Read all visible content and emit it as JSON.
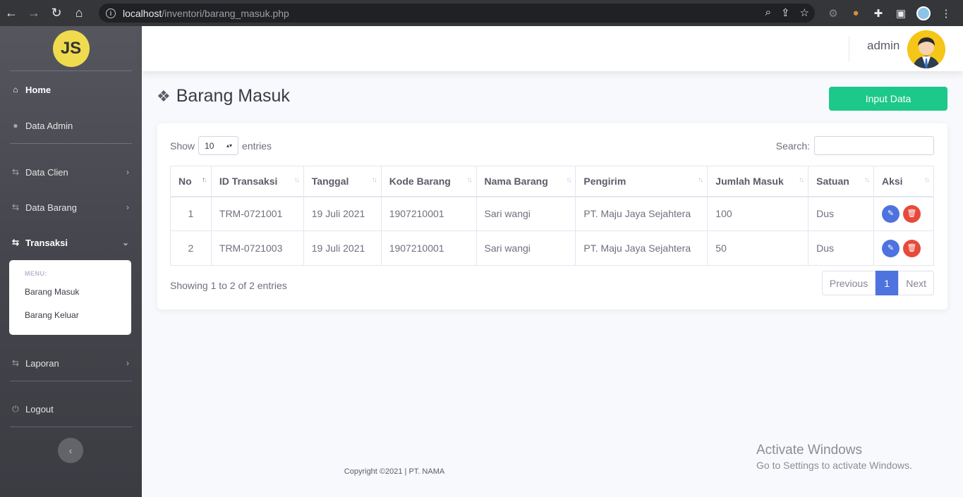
{
  "browser": {
    "url_host": "localhost",
    "url_path": "/inventori/barang_masuk.php"
  },
  "sidebar": {
    "logo": "JS",
    "items": [
      {
        "label": "Home",
        "icon": "home-icon"
      },
      {
        "label": "Data Admin",
        "icon": "user-icon"
      },
      {
        "label": "Data Clien",
        "icon": "exchange-icon"
      },
      {
        "label": "Data Barang",
        "icon": "exchange-icon"
      },
      {
        "label": "Transaksi",
        "icon": "exchange-icon"
      },
      {
        "label": "Laporan",
        "icon": "exchange-icon"
      },
      {
        "label": "Logout",
        "icon": "power-icon"
      }
    ],
    "submenu": {
      "header": "MENU:",
      "items": [
        "Barang Masuk",
        "Barang Keluar"
      ]
    }
  },
  "topbar": {
    "username": "admin"
  },
  "page": {
    "title": "Barang Masuk",
    "input_button": "Input Data"
  },
  "table_controls": {
    "show_label": "Show",
    "entries_value": "10",
    "entries_label": "entries",
    "search_label": "Search:"
  },
  "table": {
    "headers": [
      "No",
      "ID Transaksi",
      "Tanggal",
      "Kode Barang",
      "Nama Barang",
      "Pengirim",
      "Jumlah Masuk",
      "Satuan",
      "Aksi"
    ],
    "rows": [
      [
        "1",
        "TRM-0721001",
        "19 Juli 2021",
        "1907210001",
        "Sari wangi",
        "PT. Maju Jaya Sejahtera",
        "100",
        "Dus"
      ],
      [
        "2",
        "TRM-0721003",
        "19 Juli 2021",
        "1907210001",
        "Sari wangi",
        "PT. Maju Jaya Sejahtera",
        "50",
        "Dus"
      ]
    ]
  },
  "pagination": {
    "info": "Showing 1 to 2 of 2 entries",
    "previous": "Previous",
    "current": "1",
    "next": "Next"
  },
  "footer": {
    "copyright": "Copyright ©2021 | PT. NAMA"
  },
  "watermark": {
    "line1": "Activate Windows",
    "line2": "Go to Settings to activate Windows."
  },
  "colors": {
    "accent": "#4e73df",
    "success": "#1cc88a",
    "danger": "#e74a3b"
  }
}
